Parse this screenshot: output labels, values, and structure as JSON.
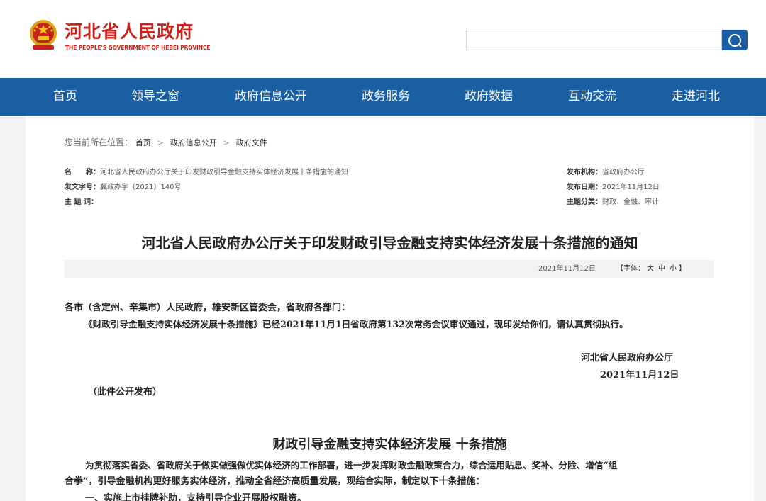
{
  "header": {
    "logo_cn": "河北省人民政府",
    "logo_en": "THE PEOPLE'S GOVERNMENT OF HEBEI PROVINCE",
    "search_placeholder": ""
  },
  "nav": {
    "items": [
      "首页",
      "领导之窗",
      "政府信息公开",
      "政务服务",
      "政府数据",
      "互动交流",
      "走进河北"
    ]
  },
  "breadcrumb": {
    "prefix": "您当前所在位置：",
    "crumbs": [
      "首页",
      "政府信息公开",
      "政府文件"
    ]
  },
  "meta": {
    "name_label": "名　　称：",
    "name_value": "河北省人民政府办公厅关于印发财政引导金融支持实体经济发展十条措施的通知",
    "docno_label": "发文字号：",
    "docno_value": "冀政办字〔2021〕140号",
    "keywords_label": "主 题 词：",
    "keywords_value": "",
    "issuer_label": "发布机构：",
    "issuer_value": "省政府办公厅",
    "date_label": "发布日期：",
    "date_value": "2021年11月12日",
    "category_label": "主题分类：",
    "category_value": "财政、金融、审计"
  },
  "document": {
    "title": "河北省人民政府办公厅关于印发财政引导金融支持实体经济发展十条措施的通知",
    "pub_date": "2021年11月12日",
    "font_label_open": "【字体：",
    "font_sizes": [
      "大",
      "中",
      "小"
    ],
    "font_label_close": "】",
    "salutation": "各市（含定州、辛集市）人民政府，雄安新区管委会，省政府各部门：",
    "para1": "《财政引导金融支持实体经济发展十条措施》已经2021年11月1日省政府第132次常务会议审议通过，现印发给你们，请认真贯彻执行。",
    "signer": "河北省人民政府办公厅",
    "sign_date": "2021年11月12日",
    "public_note": "（此件公开发布）",
    "sub_title": "财政引导金融支持实体经济发展  十条措施",
    "intro_line1": "为贯彻落实省委、省政府关于做实做强做优实体经济的工作部署，进一步发挥财政金融政策合力，综合运用贴息、奖补、分险、增信“组",
    "intro_line2": "合拳”，引导金融机构更好服务实体经济，推动全省经济高质量发展，现结合实际，制定以下十条措施：",
    "item1": "一、实施上市挂牌补助，支持引导企业开展股权融资。"
  },
  "colors": {
    "nav_bg": "#1a5fa4",
    "logo_red": "#c8231b",
    "search_btn": "#1a5da3"
  }
}
